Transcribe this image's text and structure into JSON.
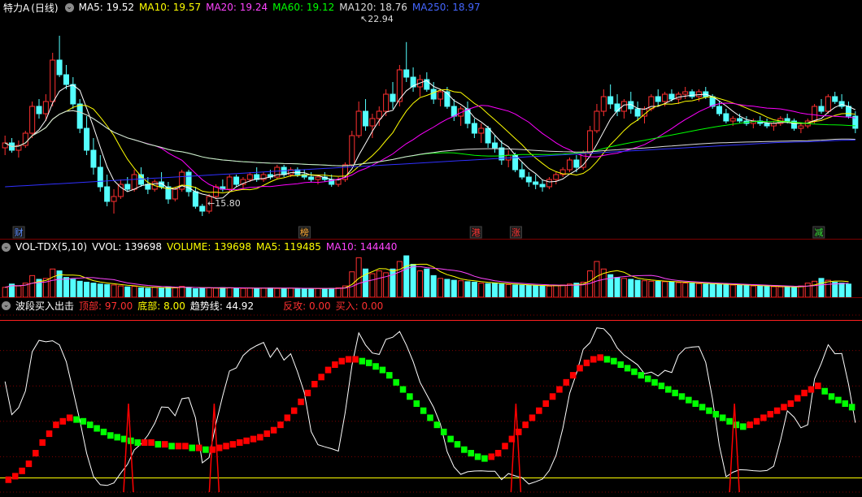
{
  "colors": {
    "up": "#ff3030",
    "down": "#54ffff",
    "ma5": "#ffffff",
    "ma10": "#ffff00",
    "ma20": "#ff00ff",
    "ma60": "#00ff00",
    "ma120": "#dddddd",
    "ma250": "#3030ff",
    "trend_up": "#ff0000",
    "trend_down": "#00ff00",
    "grid": "#800000"
  },
  "price_panel": {
    "stock_name": "特力A",
    "period": "(日线)",
    "ma5_label": "MA5:",
    "ma5_value": "19.52",
    "ma10_label": "MA10:",
    "ma10_value": "19.57",
    "ma20_label": "MA20:",
    "ma20_value": "19.24",
    "ma60_label": "MA60:",
    "ma60_value": "19.12",
    "ma120_label": "MA120:",
    "ma120_value": "18.76",
    "ma250_label": "MA250:",
    "ma250_value": "18.97",
    "high_marker": "22.94",
    "low_marker": "15.80",
    "event_marks": [
      {
        "text": "财",
        "color": "#5a8cff",
        "date_index": 3
      },
      {
        "text": "榜",
        "color": "#ffaa33",
        "date_index": 53
      },
      {
        "text": "港",
        "color": "#ff3333",
        "date_index": 83
      },
      {
        "text": "涨",
        "color": "#ff3333",
        "date_index": 90
      },
      {
        "text": "减",
        "color": "#33dd33",
        "date_index": 143
      }
    ]
  },
  "volume_panel": {
    "indicator": "VOL-TDX(5,10)",
    "vvol_label": "VVOL:",
    "vvol_value": "139698",
    "volume_label": "VOLUME:",
    "volume_value": "139698",
    "ma5_label": "MA5:",
    "ma5_value": "119485",
    "ma10_label": "MA10:",
    "ma10_value": "144440"
  },
  "indicator_panel": {
    "name": "波段买入出击",
    "top_label": "顶部:",
    "top_value": "97.00",
    "bottom_label": "底部:",
    "bottom_value": "8.00",
    "trend_label": "趋势线:",
    "trend_value": "44.92",
    "counter_label": "反攻:",
    "counter_value": "0.00",
    "buy_label": "买入:",
    "buy_value": "0.00"
  },
  "chart_data": {
    "type": "candlestick",
    "price_range": [
      15.0,
      24.0
    ],
    "ohlc": [
      [
        18.6,
        19.1,
        18.3,
        18.8
      ],
      [
        18.8,
        19.0,
        18.4,
        18.5
      ],
      [
        18.5,
        18.9,
        18.2,
        18.7
      ],
      [
        18.7,
        19.3,
        18.6,
        19.2
      ],
      [
        19.2,
        20.5,
        19.0,
        20.3
      ],
      [
        20.3,
        20.6,
        19.8,
        20.0
      ],
      [
        20.0,
        20.8,
        19.7,
        20.5
      ],
      [
        20.5,
        22.5,
        20.3,
        22.2
      ],
      [
        22.2,
        23.2,
        21.5,
        21.6
      ],
      [
        21.6,
        22.0,
        21.0,
        21.2
      ],
      [
        21.2,
        21.5,
        20.2,
        20.4
      ],
      [
        20.4,
        20.6,
        19.2,
        19.4
      ],
      [
        19.4,
        19.9,
        18.3,
        18.5
      ],
      [
        18.5,
        19.0,
        17.5,
        17.8
      ],
      [
        17.8,
        18.3,
        16.8,
        17.0
      ],
      [
        17.0,
        17.5,
        16.2,
        16.4
      ],
      [
        16.4,
        16.9,
        15.9,
        16.6
      ],
      [
        16.6,
        17.3,
        16.5,
        17.1
      ],
      [
        17.1,
        17.4,
        16.8,
        16.9
      ],
      [
        16.9,
        17.7,
        16.8,
        17.5
      ],
      [
        17.5,
        17.8,
        17.0,
        17.1
      ],
      [
        17.1,
        17.4,
        16.7,
        16.9
      ],
      [
        16.9,
        17.3,
        16.8,
        17.2
      ],
      [
        17.2,
        17.6,
        16.9,
        17.0
      ],
      [
        17.0,
        17.2,
        16.3,
        16.5
      ],
      [
        16.5,
        17.0,
        16.4,
        16.9
      ],
      [
        16.9,
        17.7,
        16.8,
        17.6
      ],
      [
        17.6,
        17.7,
        16.6,
        16.8
      ],
      [
        16.8,
        17.0,
        16.1,
        16.2
      ],
      [
        16.2,
        16.3,
        15.8,
        16.0
      ],
      [
        16.0,
        16.7,
        15.9,
        16.6
      ],
      [
        16.6,
        17.1,
        16.5,
        17.0
      ],
      [
        17.0,
        17.3,
        16.8,
        16.9
      ],
      [
        16.9,
        17.5,
        16.8,
        17.4
      ],
      [
        17.4,
        17.5,
        17.0,
        17.1
      ],
      [
        17.1,
        17.4,
        16.9,
        17.3
      ],
      [
        17.3,
        17.6,
        17.2,
        17.5
      ],
      [
        17.5,
        17.8,
        17.2,
        17.3
      ],
      [
        17.3,
        17.6,
        17.2,
        17.5
      ],
      [
        17.5,
        17.7,
        17.3,
        17.4
      ],
      [
        17.4,
        17.9,
        17.3,
        17.8
      ],
      [
        17.8,
        17.9,
        17.4,
        17.5
      ],
      [
        17.5,
        17.8,
        17.4,
        17.7
      ],
      [
        17.7,
        17.8,
        17.4,
        17.5
      ],
      [
        17.5,
        17.7,
        17.3,
        17.4
      ],
      [
        17.4,
        17.6,
        17.2,
        17.3
      ],
      [
        17.3,
        17.5,
        17.1,
        17.4
      ],
      [
        17.4,
        17.6,
        17.2,
        17.3
      ],
      [
        17.3,
        17.5,
        17.0,
        17.1
      ],
      [
        17.1,
        17.4,
        17.0,
        17.3
      ],
      [
        17.3,
        18.0,
        17.2,
        17.9
      ],
      [
        17.9,
        19.3,
        17.8,
        19.1
      ],
      [
        19.1,
        20.5,
        19.0,
        20.1
      ],
      [
        20.1,
        20.6,
        19.3,
        19.5
      ],
      [
        19.5,
        20.0,
        19.0,
        19.8
      ],
      [
        19.8,
        20.3,
        19.5,
        20.1
      ],
      [
        20.1,
        21.0,
        19.9,
        20.8
      ],
      [
        20.8,
        21.3,
        20.2,
        20.5
      ],
      [
        20.5,
        22.0,
        20.3,
        21.8
      ],
      [
        21.8,
        22.94,
        21.3,
        21.5
      ],
      [
        21.5,
        21.9,
        20.9,
        21.1
      ],
      [
        21.1,
        21.6,
        20.7,
        21.4
      ],
      [
        21.4,
        21.7,
        20.9,
        21.0
      ],
      [
        21.0,
        21.3,
        20.4,
        20.6
      ],
      [
        20.6,
        21.0,
        20.3,
        20.9
      ],
      [
        20.9,
        21.1,
        20.2,
        20.3
      ],
      [
        20.3,
        20.6,
        19.7,
        19.9
      ],
      [
        19.9,
        20.3,
        19.5,
        20.2
      ],
      [
        20.2,
        20.5,
        19.4,
        19.6
      ],
      [
        19.6,
        19.8,
        19.0,
        19.2
      ],
      [
        19.2,
        19.6,
        18.8,
        19.4
      ],
      [
        19.4,
        19.5,
        18.6,
        18.8
      ],
      [
        18.8,
        19.1,
        18.4,
        18.6
      ],
      [
        18.6,
        18.9,
        17.9,
        18.1
      ],
      [
        18.1,
        18.5,
        17.8,
        18.3
      ],
      [
        18.3,
        18.4,
        17.6,
        17.7
      ],
      [
        17.7,
        18.0,
        17.3,
        17.4
      ],
      [
        17.4,
        17.6,
        17.0,
        17.2
      ],
      [
        17.2,
        17.5,
        16.9,
        17.1
      ],
      [
        17.1,
        17.3,
        16.8,
        17.0
      ],
      [
        17.0,
        17.4,
        16.9,
        17.3
      ],
      [
        17.3,
        17.6,
        17.1,
        17.5
      ],
      [
        17.5,
        17.8,
        17.4,
        17.7
      ],
      [
        17.7,
        18.2,
        17.6,
        18.1
      ],
      [
        18.1,
        18.3,
        17.6,
        17.8
      ],
      [
        17.8,
        18.5,
        17.7,
        18.4
      ],
      [
        18.4,
        19.5,
        18.3,
        19.3
      ],
      [
        19.3,
        20.4,
        19.2,
        20.1
      ],
      [
        20.1,
        21.0,
        19.9,
        20.7
      ],
      [
        20.7,
        21.2,
        20.2,
        20.4
      ],
      [
        20.4,
        20.8,
        19.9,
        20.1
      ],
      [
        20.1,
        20.6,
        19.8,
        20.5
      ],
      [
        20.5,
        20.9,
        20.0,
        20.2
      ],
      [
        20.2,
        20.5,
        19.7,
        19.9
      ],
      [
        19.9,
        20.3,
        19.6,
        20.2
      ],
      [
        20.2,
        20.8,
        20.1,
        20.7
      ],
      [
        20.7,
        21.0,
        20.3,
        20.5
      ],
      [
        20.5,
        20.9,
        20.3,
        20.8
      ],
      [
        20.8,
        21.0,
        20.5,
        20.6
      ],
      [
        20.6,
        20.9,
        20.4,
        20.8
      ],
      [
        20.8,
        21.1,
        20.6,
        20.9
      ],
      [
        20.9,
        21.0,
        20.6,
        20.7
      ],
      [
        20.7,
        21.0,
        20.5,
        20.9
      ],
      [
        20.9,
        21.1,
        20.6,
        20.7
      ],
      [
        20.7,
        20.8,
        20.2,
        20.3
      ],
      [
        20.3,
        20.5,
        19.9,
        20.0
      ],
      [
        20.0,
        20.2,
        19.6,
        19.7
      ],
      [
        19.7,
        19.9,
        19.5,
        19.8
      ],
      [
        19.8,
        20.0,
        19.6,
        19.7
      ],
      [
        19.7,
        19.9,
        19.5,
        19.6
      ],
      [
        19.6,
        19.8,
        19.4,
        19.7
      ],
      [
        19.7,
        19.9,
        19.5,
        19.6
      ],
      [
        19.6,
        19.8,
        19.4,
        19.5
      ],
      [
        19.5,
        19.7,
        19.3,
        19.6
      ],
      [
        19.6,
        19.9,
        19.5,
        19.8
      ],
      [
        19.8,
        20.0,
        19.6,
        19.7
      ],
      [
        19.7,
        19.8,
        19.3,
        19.4
      ],
      [
        19.4,
        19.6,
        19.2,
        19.5
      ],
      [
        19.5,
        19.8,
        19.4,
        19.7
      ],
      [
        19.7,
        20.4,
        19.6,
        20.3
      ],
      [
        20.3,
        20.6,
        20.0,
        20.1
      ],
      [
        20.1,
        20.8,
        20.0,
        20.7
      ],
      [
        20.7,
        20.9,
        20.4,
        20.5
      ],
      [
        20.5,
        20.8,
        20.2,
        20.3
      ],
      [
        20.3,
        20.5,
        19.8,
        19.9
      ],
      [
        19.9,
        20.1,
        19.2,
        19.4
      ]
    ],
    "volume": [
      105000,
      140000,
      120000,
      150000,
      230000,
      190000,
      200000,
      300000,
      280000,
      210000,
      190000,
      170000,
      160000,
      150000,
      140000,
      135000,
      130000,
      120000,
      110000,
      115000,
      100000,
      95000,
      105000,
      98000,
      110000,
      100000,
      115000,
      105000,
      90000,
      95000,
      100000,
      98000,
      102000,
      100000,
      96000,
      94000,
      98000,
      95000,
      97000,
      99000,
      93000,
      95000,
      96000,
      94000,
      92000,
      90000,
      93000,
      91000,
      95000,
      100000,
      120000,
      270000,
      420000,
      300000,
      250000,
      280000,
      260000,
      300000,
      380000,
      440000,
      350000,
      280000,
      300000,
      230000,
      200000,
      190000,
      180000,
      175000,
      165000,
      160000,
      150000,
      145000,
      150000,
      140000,
      135000,
      130000,
      128000,
      125000,
      122000,
      120000,
      118000,
      125000,
      130000,
      140000,
      150000,
      160000,
      280000,
      380000,
      300000,
      240000,
      210000,
      200000,
      190000,
      180000,
      175000,
      170000,
      168000,
      165000,
      160000,
      155000,
      150000,
      148000,
      145000,
      140000,
      138000,
      135000,
      133000,
      130000,
      128000,
      125000,
      120000,
      118000,
      115000,
      112000,
      110000,
      108000,
      105000,
      120000,
      150000,
      170000,
      200000,
      180000,
      160000,
      150000,
      139698
    ],
    "indicator_ref_lines": {
      "top": 97.0,
      "bottom": 8.0
    },
    "indicator_trend": [
      5,
      7,
      9,
      12,
      16,
      22,
      28,
      33,
      38,
      40,
      42,
      41,
      40,
      38,
      36,
      34,
      32,
      31,
      30,
      29,
      28,
      28,
      28,
      27,
      27,
      26,
      26,
      26,
      25,
      25,
      24,
      24,
      25,
      26,
      27,
      28,
      29,
      30,
      31,
      33,
      35,
      38,
      42,
      46,
      51,
      56,
      61,
      65,
      69,
      72,
      74,
      75,
      75,
      74,
      73,
      71,
      69,
      66,
      62,
      58,
      54,
      50,
      46,
      42,
      38,
      34,
      30,
      27,
      24,
      22,
      20,
      19,
      20,
      22,
      26,
      30,
      34,
      38,
      42,
      46,
      50,
      54,
      58,
      62,
      66,
      70,
      73,
      75,
      76,
      75,
      74,
      72,
      70,
      68,
      66,
      64,
      62,
      60,
      58,
      56,
      54,
      52,
      50,
      48,
      46,
      44,
      42,
      40,
      38,
      37,
      38,
      40,
      42,
      44,
      46,
      48,
      50,
      53,
      56,
      58,
      60,
      57,
      54,
      52,
      50,
      48
    ]
  }
}
